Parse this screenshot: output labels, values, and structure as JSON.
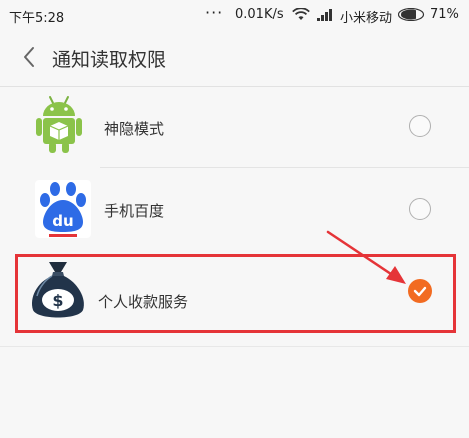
{
  "status_bar": {
    "time": "下午5:28",
    "dots": "···",
    "speed": "0.01K/s",
    "carrier": "小米移动",
    "battery": "71%"
  },
  "header": {
    "title": "通知读取权限"
  },
  "apps": [
    {
      "label": "神隐模式",
      "icon": "android-app-icon",
      "checked": false
    },
    {
      "label": "手机百度",
      "icon": "baidu-app-icon",
      "checked": false
    },
    {
      "label": "个人收款服务",
      "icon": "money-bag-icon",
      "checked": true
    }
  ],
  "colors": {
    "accent": "#f26b21",
    "highlight": "#e53438"
  }
}
